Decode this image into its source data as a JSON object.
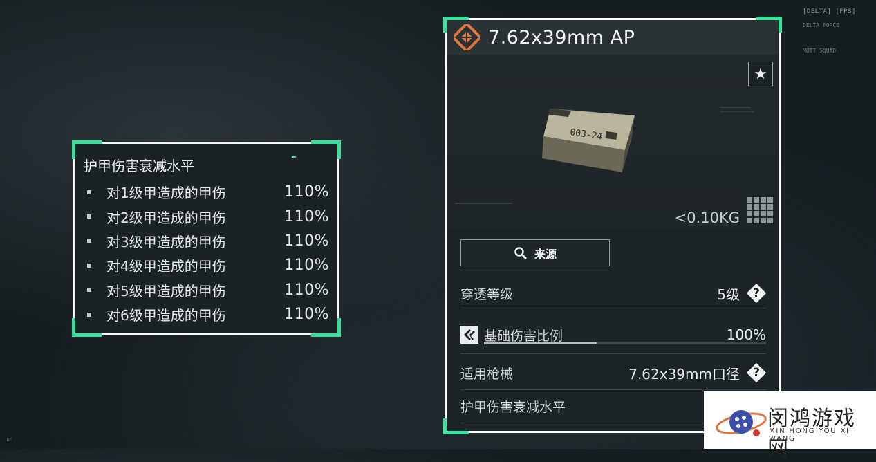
{
  "hud": {
    "top_right_title": "[DELTA] [FPS]",
    "top_right_lines": [
      "DELTA FORCE",
      "MUTT SQUAD"
    ],
    "bottom_left_line": "DF"
  },
  "armor_tooltip": {
    "title": "护甲伤害衰减水平",
    "rows": [
      {
        "label": "对1级甲造成的甲伤",
        "value": "110%"
      },
      {
        "label": "对2级甲造成的甲伤",
        "value": "110%"
      },
      {
        "label": "对3级甲造成的甲伤",
        "value": "110%"
      },
      {
        "label": "对4级甲造成的甲伤",
        "value": "110%"
      },
      {
        "label": "对5级甲造成的甲伤",
        "value": "110%"
      },
      {
        "label": "对6级甲造成的甲伤",
        "value": "110%"
      }
    ]
  },
  "item": {
    "name": "7.62x39mm AP",
    "weight": "<0.10KG",
    "box_label": "003-24",
    "favorite_icon": "star-icon",
    "source_button": "来源",
    "stats": {
      "penetration_label": "穿透等级",
      "penetration_value": "5级",
      "base_damage_label": "基础伤害比例",
      "base_damage_value": "100%",
      "base_damage_fraction": 0.4,
      "weapon_label": "适用枪械",
      "weapon_value": "7.62x39mm口径",
      "armor_decay_label": "护甲伤害衰减水平"
    }
  },
  "watermark": {
    "name_cn": "闵鸿游戏网",
    "name_en": "MIN HONG YOU XI WANG"
  },
  "colors": {
    "accent_green": "#39e6a0",
    "brand_orange": "#e0773a",
    "panel_bg": "#1c2427"
  }
}
